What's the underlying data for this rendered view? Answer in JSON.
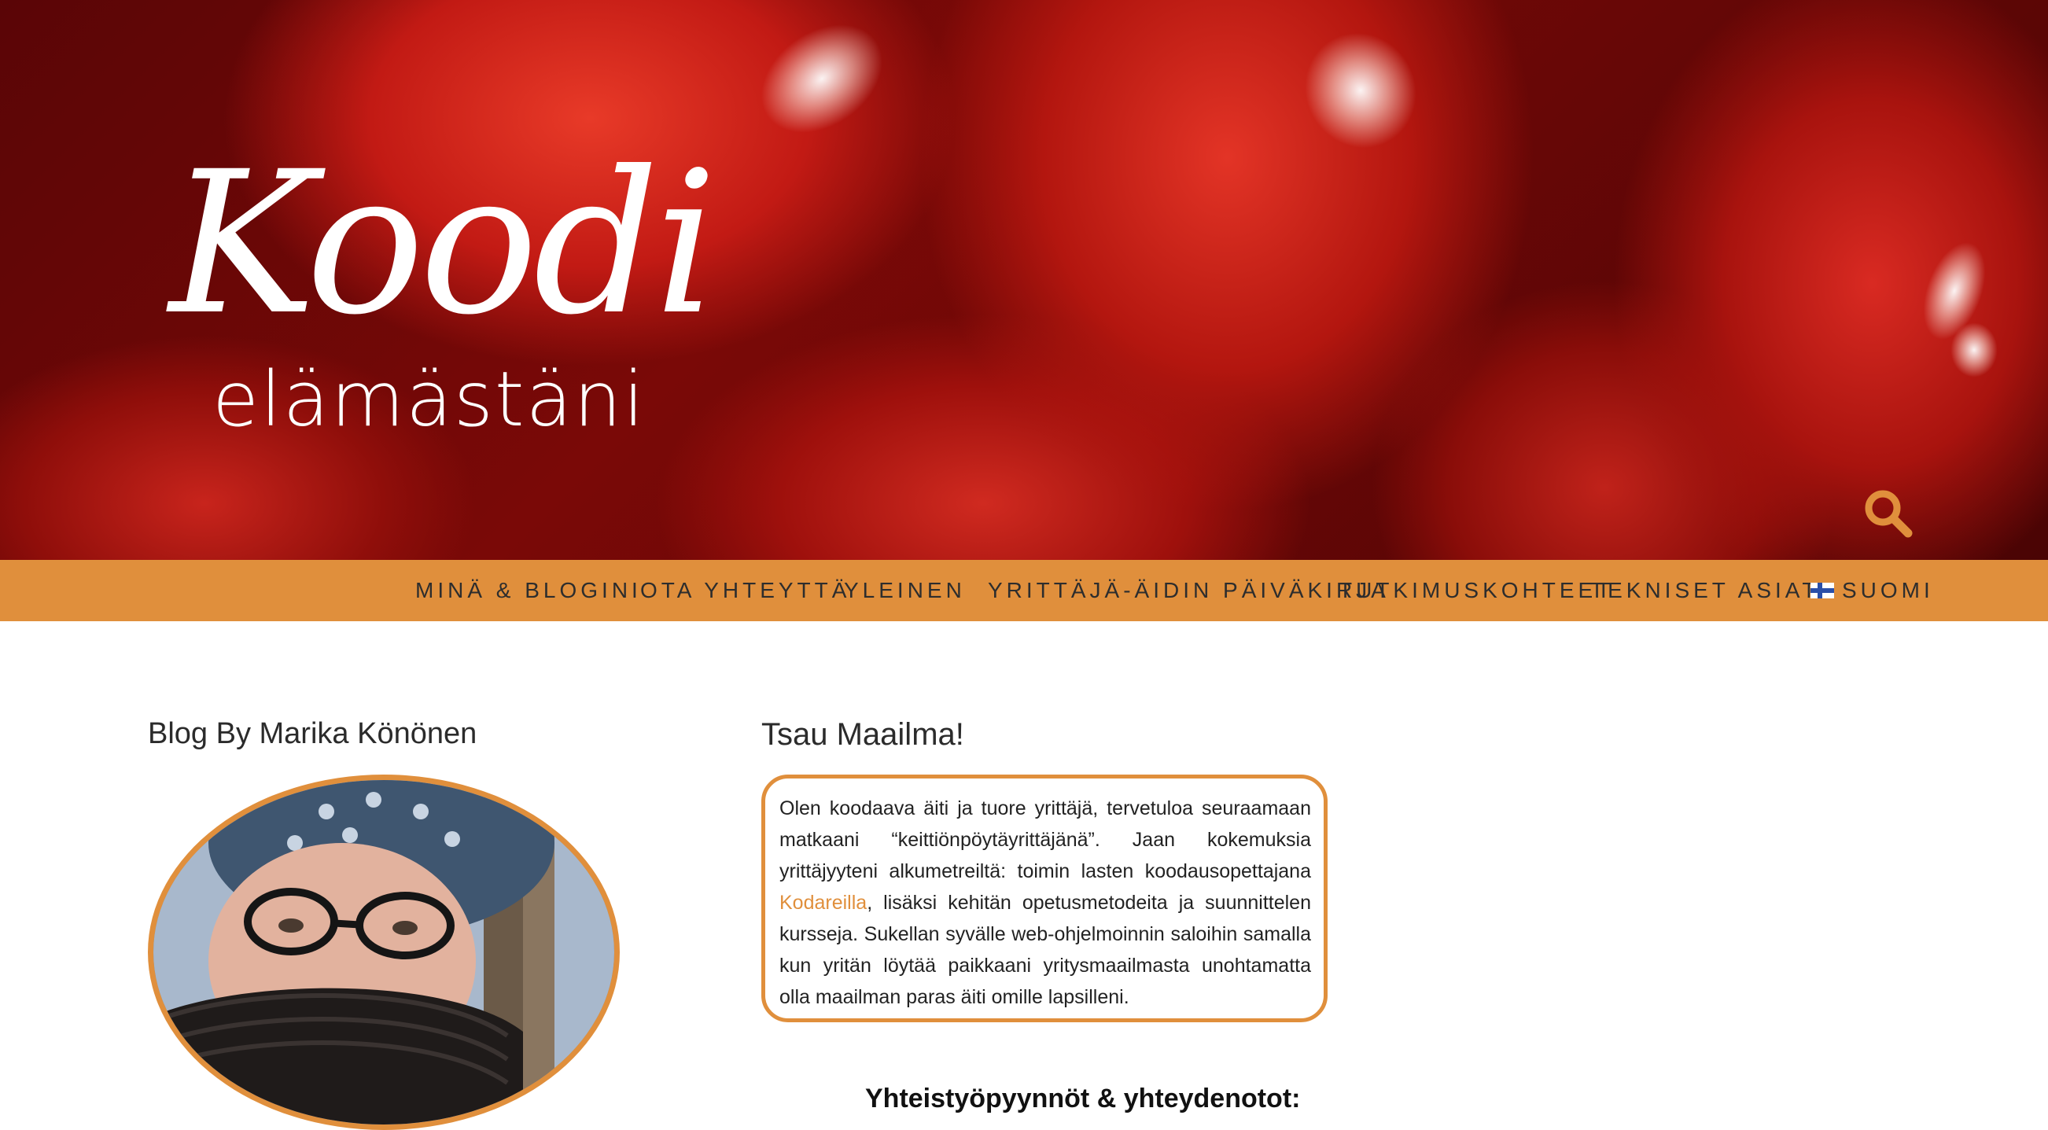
{
  "header": {
    "logo_script": "Koodi",
    "logo_sub": "elämästäni",
    "search_icon": "search-icon",
    "accent": "#e08f3c"
  },
  "nav": {
    "items": [
      {
        "label": "MINÄ & BLOGINI"
      },
      {
        "label": "OTA YHTEYTTÄ"
      },
      {
        "label": "YLEINEN"
      },
      {
        "label": "YRITTÄJÄ-ÄIDIN PÄIVÄKIRJA"
      },
      {
        "label": "TUTKIMUSKOHTEET"
      },
      {
        "label": "TEKNISET ASIAT"
      },
      {
        "label": "SUOMI",
        "icon": "finland-flag-icon"
      }
    ]
  },
  "sidebar": {
    "title": "Blog By Marika Könönen"
  },
  "main": {
    "post_title": "Tsau Maailma!",
    "intro_part1": "Olen koodaava äiti ja tuore yrittäjä, tervetuloa seuraamaan matkaani “keittiönpöytäyrittäjänä”. Jaan kokemuksia yrittäjyyteni alkumetreiltä: toimin lasten koodausopettajana ",
    "intro_link": "Kodareilla",
    "intro_part2": ", lisäksi kehitän opetusmetodeita ja suunnittelen kursseja. Sukellan syvälle web-ohjelmoinnin saloihin samalla kun yritän löytää paikkaani yritysmaailmasta unohtamatta olla maailman paras äiti omille lapsilleni.",
    "contact_title": "Yhteistyöpyynnöt & yhteydenotot:"
  }
}
